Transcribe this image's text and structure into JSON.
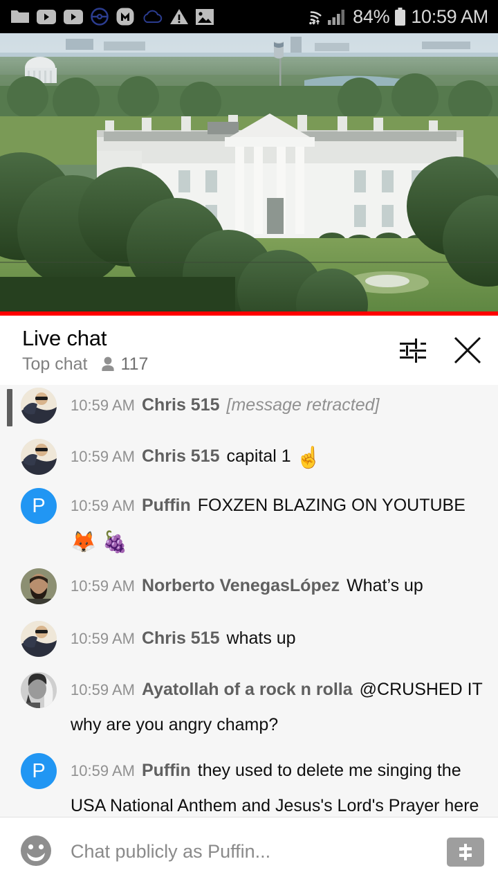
{
  "statusbar": {
    "icons_left": [
      "folder-icon",
      "youtube-icon",
      "youtube-icon",
      "pokemon-go-icon",
      "monzo-icon",
      "cloud-icon",
      "warning-triangle-icon",
      "photo-icon"
    ],
    "wifi_icon": "wifi-icon",
    "signal_icon": "cellular-signal-icon",
    "battery_percent": "84%",
    "battery_icon": "battery-icon",
    "clock": "10:59 AM",
    "background": "#000000",
    "foreground": "#d9d9d9"
  },
  "video": {
    "alt": "Live stream of the White House with Jefferson Memorial in distance",
    "progress_color": "#ff0000",
    "progress_percent": 100
  },
  "chat_header": {
    "title": "Live chat",
    "mode_label": "Top chat",
    "viewer_icon": "person-icon",
    "viewer_count": "117",
    "settings_icon": "chat-settings-sliders-icon",
    "close_icon": "close-icon"
  },
  "messages": [
    {
      "time": "10:59 AM",
      "author": "Chris 515",
      "text": "[message retracted]",
      "retracted": true,
      "avatar_type": "photo-sunglasses",
      "emoji": ""
    },
    {
      "time": "10:59 AM",
      "author": "Chris 515",
      "text": "capital 1",
      "retracted": false,
      "avatar_type": "photo-sunglasses",
      "emoji": "☝️"
    },
    {
      "time": "10:59 AM",
      "author": "Puffin",
      "text": "FOXZEN BLAZING ON YOUTUBE",
      "retracted": false,
      "avatar_type": "letter",
      "avatar_letter": "P",
      "avatar_color": "#2196f3",
      "emoji": "🦊 🍇"
    },
    {
      "time": "10:59 AM",
      "author": "Norberto VenegasLópez",
      "text": "What’s up",
      "retracted": false,
      "avatar_type": "photo-beard",
      "emoji": ""
    },
    {
      "time": "10:59 AM",
      "author": "Chris 515",
      "text": "whats up",
      "retracted": false,
      "avatar_type": "photo-sunglasses",
      "emoji": ""
    },
    {
      "time": "10:59 AM",
      "author": "Ayatollah of a rock n rolla",
      "text": "@CRUSHED IT why are you angry champ?",
      "retracted": false,
      "avatar_type": "photo-bw",
      "emoji": ""
    },
    {
      "time": "10:59 AM",
      "author": "Puffin",
      "text": "they used to delete me singing the USA National Anthem and Jesus's Lord's Prayer here",
      "retracted": false,
      "avatar_type": "letter",
      "avatar_letter": "P",
      "avatar_color": "#2196f3",
      "emoji": "🍇"
    }
  ],
  "inputbar": {
    "emoji_icon": "emoji-smiley-icon",
    "placeholder": "Chat publicly as Puffin...",
    "value": "",
    "superchat_icon": "super-chat-dollar-icon"
  }
}
